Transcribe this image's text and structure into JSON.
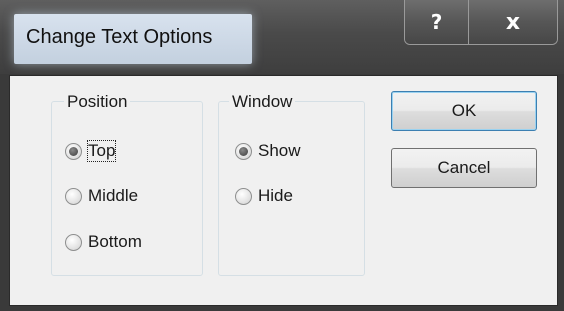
{
  "window": {
    "title": "Change Text Options",
    "help_glyph": "?",
    "close_glyph": "x"
  },
  "position_group": {
    "legend": "Position",
    "options": [
      {
        "label": "Top",
        "checked": true,
        "focused": true
      },
      {
        "label": "Middle",
        "checked": false
      },
      {
        "label": "Bottom",
        "checked": false
      }
    ]
  },
  "window_group": {
    "legend": "Window",
    "options": [
      {
        "label": "Show",
        "checked": true
      },
      {
        "label": "Hide",
        "checked": false
      }
    ]
  },
  "buttons": {
    "ok_label": "OK",
    "cancel_label": "Cancel"
  },
  "colors": {
    "frame": "#3a3a3a",
    "title_plate": "#c8d4e2",
    "client_bg": "#f0f0f0",
    "default_button_border": "#3c7fb1"
  }
}
